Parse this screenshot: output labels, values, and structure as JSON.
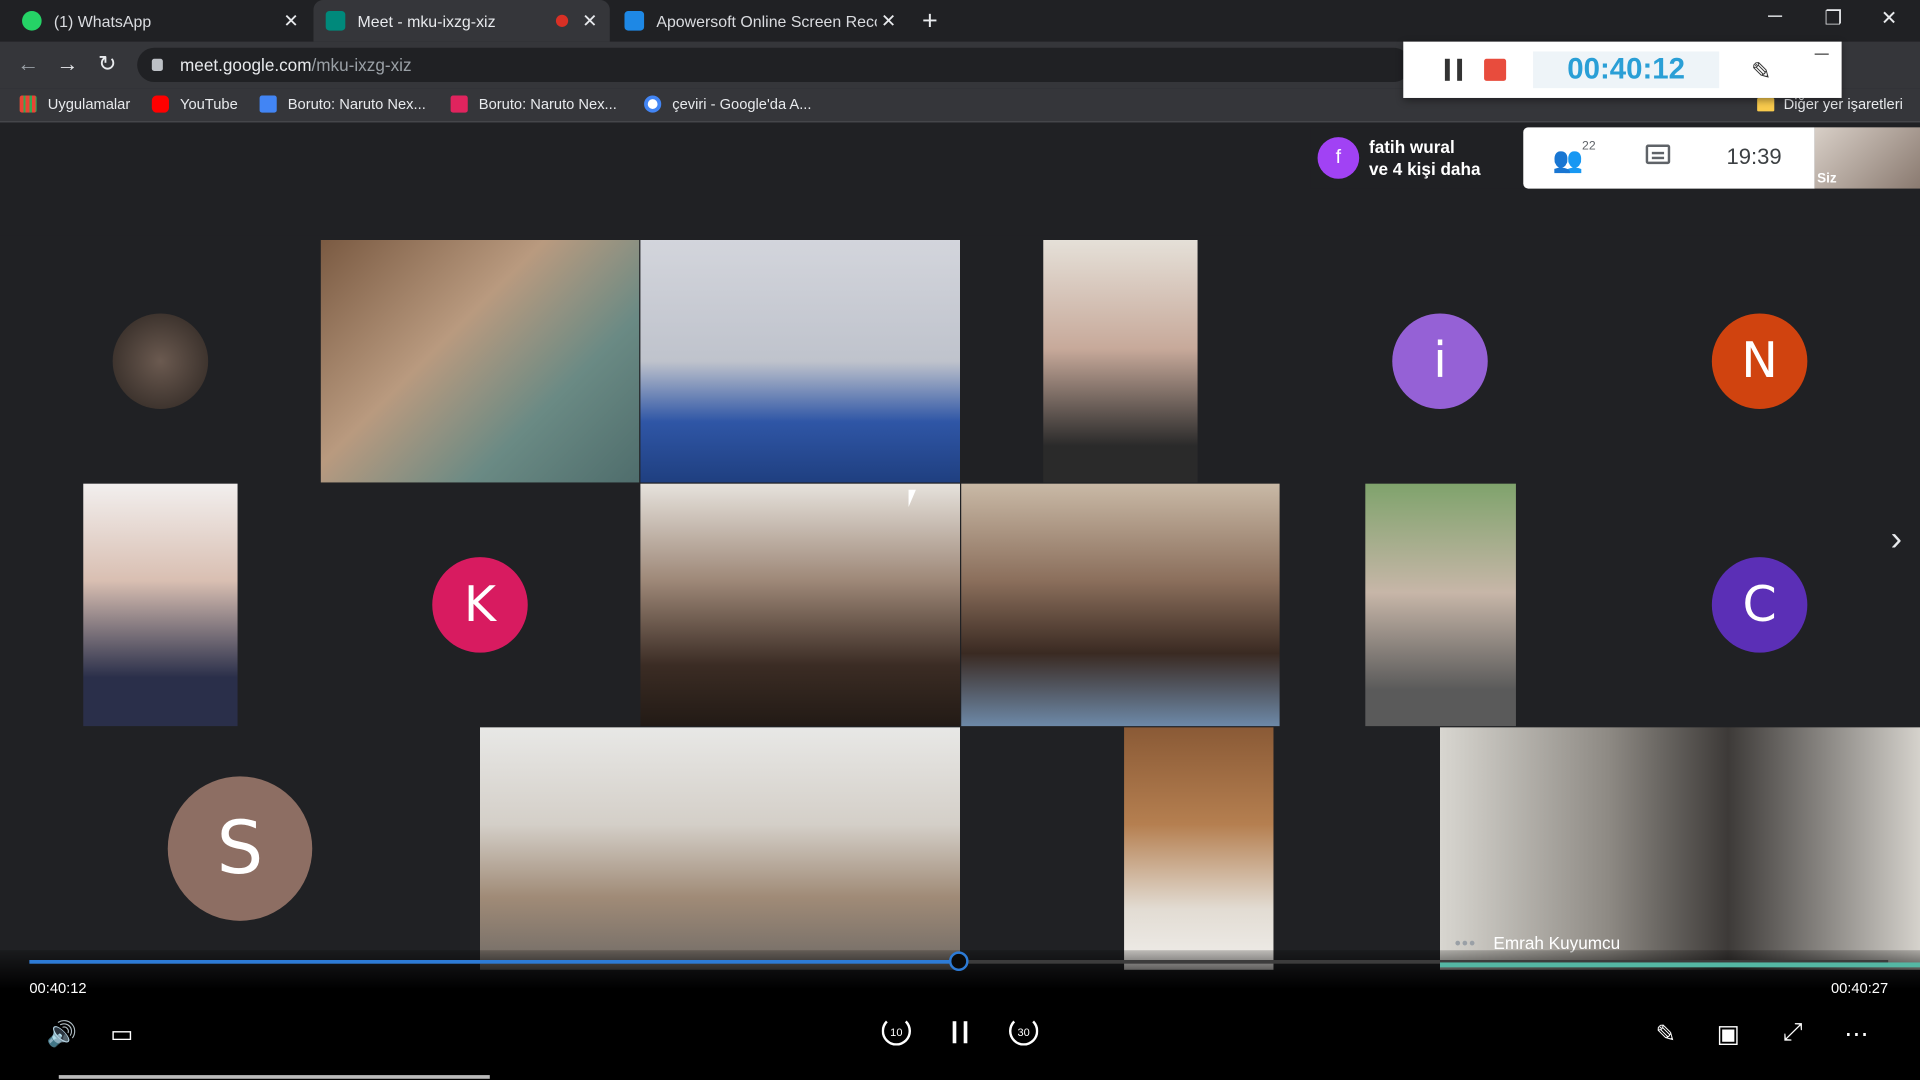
{
  "browser": {
    "tabs": [
      {
        "label": "(1) WhatsApp",
        "active": false
      },
      {
        "label": "Meet - mku-ixzg-xiz",
        "active": true,
        "recording": true
      },
      {
        "label": "Apowersoft Online Screen Recor",
        "active": false
      }
    ],
    "new_tab_icon": "+",
    "url_host": "meet.google.com",
    "url_path": "/mku-ixzg-xiz",
    "bookmarks": [
      {
        "label": "Uygulamalar",
        "icon": "apps-grid-icon",
        "color": "#ea4335"
      },
      {
        "label": "YouTube",
        "icon": "youtube-icon",
        "color": "#ff0000"
      },
      {
        "label": "Boruto: Naruto Nex...",
        "icon": "boruto-icon",
        "color": "#4285f4"
      },
      {
        "label": "Boruto: Naruto Nex...",
        "icon": "italic-i-icon",
        "color": "#e0245e"
      },
      {
        "label": "çeviri - Google'da A...",
        "icon": "google-icon",
        "color": "#ffffff"
      }
    ],
    "other_bookmarks": "Diğer yer işaretleri"
  },
  "recorder": {
    "elapsed": "00:40:12",
    "accent": "#2a9fd6",
    "stop_color": "#e84c3d"
  },
  "meet": {
    "presenter_initial": "f",
    "presenter_name": "fatih wural",
    "presenter_more": "ve 4 kişi daha",
    "participants_count": "22",
    "clock": "19:39",
    "self_label": "Siz",
    "tiles": [
      {
        "kind": "letter",
        "letter": "i",
        "color": "#9561d6"
      },
      {
        "kind": "letter",
        "letter": "N",
        "color": "#d0430f"
      },
      {
        "kind": "letter",
        "letter": "K",
        "color": "#d81b60"
      },
      {
        "kind": "letter",
        "letter": "C",
        "color": "#5b2fb6"
      },
      {
        "kind": "letter",
        "letter": "S",
        "color": "#8d6e63"
      }
    ],
    "speaker_name": "Emrah Kuyumcu",
    "speaker_dots": "•••"
  },
  "player": {
    "current_time": "00:40:12",
    "duration": "00:40:27",
    "progress": 0.5,
    "rewind_seconds": "10",
    "forward_seconds": "30"
  }
}
